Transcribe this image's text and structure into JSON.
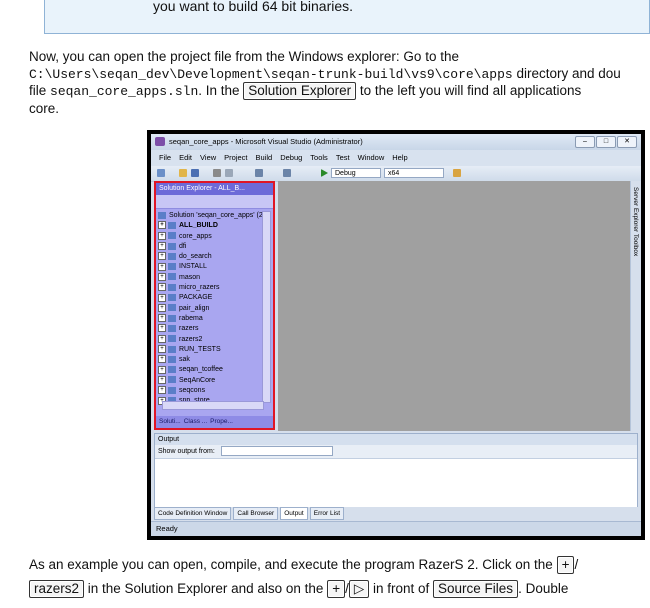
{
  "note_text": "you want to build 64 bit binaries.",
  "para1": {
    "line1": "Now, you can open the project file from the Windows explorer: Go to the",
    "line2_path": "C:\\Users\\seqan_dev\\Development\\seqan-trunk-build\\vs9\\core\\apps",
    "line2_rest": " directory and dou",
    "line3_pre": "file ",
    "line3_file": "seqan_core_apps.sln",
    "line3_mid": ". In the ",
    "line3_button": "Solution Explorer",
    "line3_post": " to the left you will find all applications",
    "line4": "core."
  },
  "vs": {
    "title": "seqan_core_apps - Microsoft Visual Studio (Administrator)",
    "menu": [
      "File",
      "Edit",
      "View",
      "Project",
      "Build",
      "Debug",
      "Tools",
      "Test",
      "Window",
      "Help"
    ],
    "config": "Debug",
    "platform": "x64",
    "solution_explorer_title": "Solution Explorer - ALL_B...",
    "solution_root": "Solution 'seqan_core_apps' (2",
    "projects": [
      "ALL_BUILD",
      "core_apps",
      "dfi",
      "do_search",
      "INSTALL",
      "mason",
      "micro_razers",
      "PACKAGE",
      "pair_align",
      "rabema",
      "razers",
      "razers2",
      "RUN_TESTS",
      "sak",
      "seqan_tcoffee",
      "SeqAnCore",
      "seqcons",
      "snp_store"
    ],
    "se_tabs": [
      "Soluti...",
      "Class ...",
      "Prope..."
    ],
    "right_tabs": "Server Explorer  Toolbox",
    "output_title": "Output",
    "output_label": "Show output from:",
    "bottom_tabs": [
      "Code Definition Window",
      "Call Browser",
      "Output",
      "Error List"
    ],
    "status": "Ready"
  },
  "para2": {
    "line1": "As an example you can open, compile, and execute the program RazerS 2. Click on the",
    "plus": "+",
    "slash": "/",
    "line2_button": "razers2",
    "line2_mid": " in the Solution Explorer and also on the ",
    "play": "▷",
    "line2_mid2": " in front of ",
    "line2_button2": "Source Files",
    "line2_post": ". Double"
  }
}
